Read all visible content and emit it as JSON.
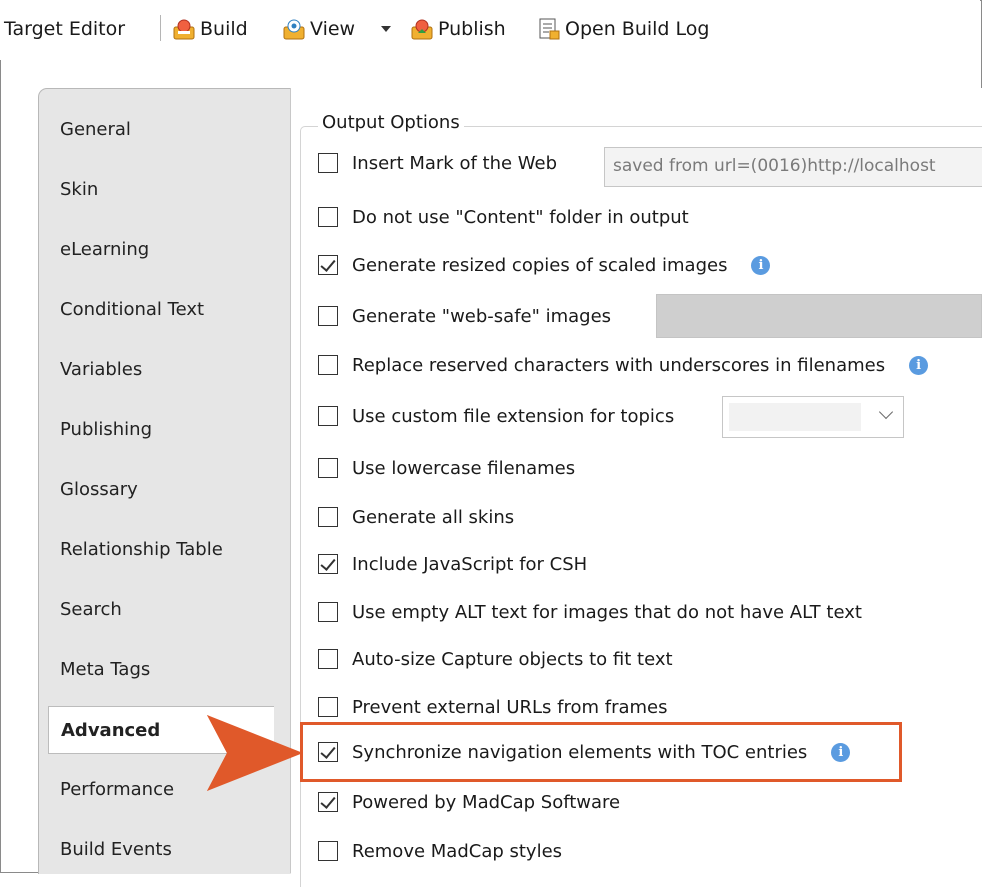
{
  "toolbar": {
    "title": "Target Editor",
    "build_label": "Build",
    "view_label": "View",
    "publish_label": "Publish",
    "open_build_log_label": "Open Build Log"
  },
  "tabs": [
    {
      "label": "General"
    },
    {
      "label": "Skin"
    },
    {
      "label": "eLearning"
    },
    {
      "label": "Conditional Text"
    },
    {
      "label": "Variables"
    },
    {
      "label": "Publishing"
    },
    {
      "label": "Glossary"
    },
    {
      "label": "Relationship Table"
    },
    {
      "label": "Search"
    },
    {
      "label": "Meta Tags"
    },
    {
      "label": "Advanced"
    },
    {
      "label": "Performance"
    },
    {
      "label": "Build Events"
    }
  ],
  "active_tab": "Advanced",
  "output_options": {
    "legend": "Output Options",
    "mark_of_web_value": "saved from url=(0016)http://localhost",
    "items": [
      {
        "label": "Insert Mark of the Web",
        "checked": false
      },
      {
        "label": "Do not use \"Content\" folder in output",
        "checked": false
      },
      {
        "label": "Generate resized copies of scaled images",
        "checked": true
      },
      {
        "label": "Generate \"web-safe\" images",
        "checked": false
      },
      {
        "label": "Replace reserved characters with underscores in filenames",
        "checked": false
      },
      {
        "label": "Use custom file extension for topics",
        "checked": false
      },
      {
        "label": "Use lowercase filenames",
        "checked": false
      },
      {
        "label": "Generate all skins",
        "checked": false
      },
      {
        "label": "Include JavaScript for CSH",
        "checked": true
      },
      {
        "label": "Use empty ALT text for images that do not have ALT text",
        "checked": false
      },
      {
        "label": "Auto-size Capture objects to fit text",
        "checked": false
      },
      {
        "label": "Prevent external URLs from frames",
        "checked": false
      },
      {
        "label": "Synchronize navigation elements with TOC entries",
        "checked": true
      },
      {
        "label": "Powered by MadCap Software",
        "checked": true
      },
      {
        "label": "Remove MadCap styles",
        "checked": false
      }
    ]
  },
  "colors": {
    "highlight": "#e0592a",
    "info": "#5a9be0"
  }
}
